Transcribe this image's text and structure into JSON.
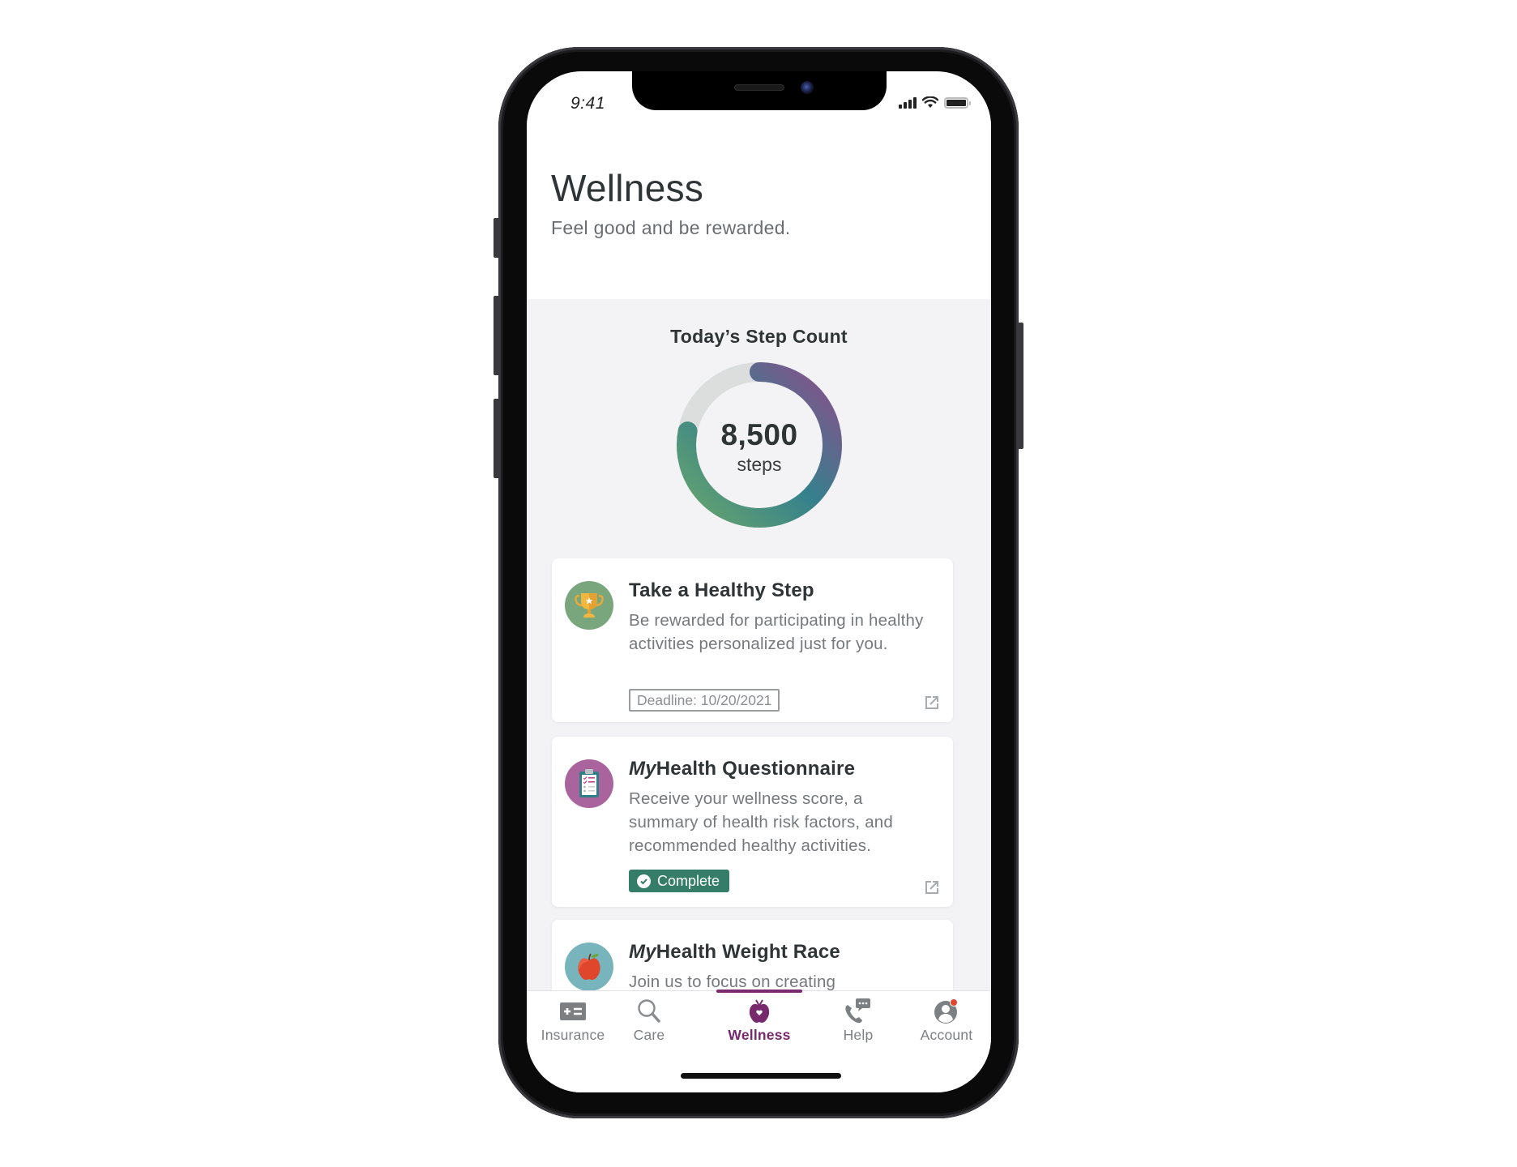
{
  "status_bar": {
    "time": "9:41",
    "icons": [
      "cellular-signal-icon",
      "wifi-icon",
      "battery-icon"
    ]
  },
  "header": {
    "title": "Wellness",
    "subtitle": "Feel good and be rewarded."
  },
  "step_count": {
    "title": "Today’s Step Count",
    "value": "8,500",
    "unit": "steps",
    "progress_fraction": 0.78,
    "gradient_colors": [
      "#8a4f8c",
      "#35808d",
      "#67a56d"
    ],
    "track_color": "#dcdedd"
  },
  "cards": [
    {
      "icon": "trophy-icon",
      "icon_bg": "#7aa67d",
      "title_italic": "",
      "title": "Take a Healthy Step",
      "description": "Be rewarded for participating in healthy activities personalized just for you.",
      "badge": "Deadline: 10/20/2021",
      "badge_type": "deadline",
      "action_icon": "external-link-icon"
    },
    {
      "icon": "clipboard-icon",
      "icon_bg": "#a9649e",
      "title_italic": "My",
      "title": "Health Questionnaire",
      "description": "Receive your wellness score, a summary of health risk factors, and recommended healthy activities.",
      "badge": "Complete",
      "badge_type": "complete",
      "badge_color": "#357d68",
      "action_icon": "external-link-icon"
    },
    {
      "icon": "apple-icon",
      "icon_bg": "#78b4bc",
      "title_italic": "My",
      "title": "Health Weight Race",
      "description": "Join us to focus on creating"
    }
  ],
  "tab_bar": {
    "active_color": "#772a6c",
    "tabs": [
      {
        "label": "Insurance",
        "icon": "insurance-card-icon",
        "active": false
      },
      {
        "label": "Care",
        "icon": "search-icon",
        "active": false
      },
      {
        "label": "Wellness",
        "icon": "apple-heart-icon",
        "active": true
      },
      {
        "label": "Help",
        "icon": "phone-chat-icon",
        "active": false
      },
      {
        "label": "Account",
        "icon": "account-icon",
        "active": false,
        "notification_dot": true
      }
    ]
  }
}
